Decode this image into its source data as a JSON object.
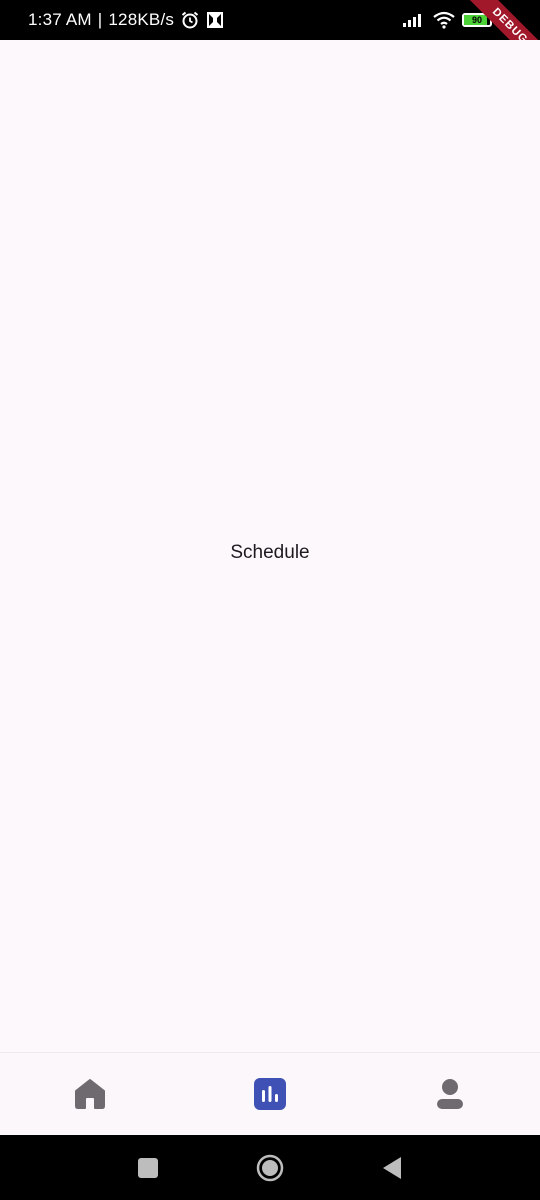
{
  "status_bar": {
    "time": "1:37 AM",
    "separator": "|",
    "speed": "128KB/s",
    "battery_level": "90",
    "battery_percent": 90,
    "icons": [
      "alarm-icon",
      "app-notification-icon",
      "signal-icon",
      "wifi-icon",
      "battery-icon",
      "charging-icon"
    ]
  },
  "debug_banner": {
    "label": "DEBUG"
  },
  "main": {
    "title": "Schedule"
  },
  "bottom_nav": {
    "items": [
      {
        "icon": "home-icon",
        "active": false
      },
      {
        "icon": "bar-chart-icon",
        "active": true
      },
      {
        "icon": "person-icon",
        "active": false
      }
    ],
    "active_color": "#3f51b5",
    "inactive_color": "#6f6a70"
  },
  "system_nav": {
    "buttons": [
      "recents-square-icon",
      "home-circle-icon",
      "back-triangle-icon"
    ]
  }
}
